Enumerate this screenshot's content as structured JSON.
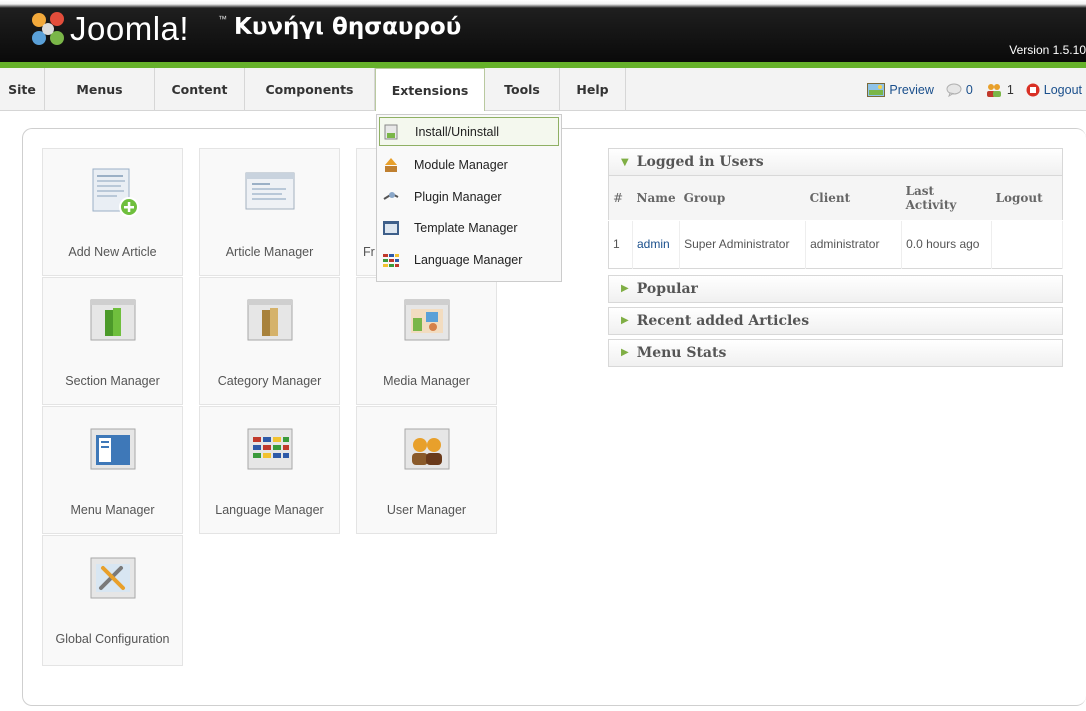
{
  "header": {
    "logo_text": "Joomla!",
    "logo_tm": "™",
    "site_title": "Κυνήγι θησαυρού",
    "version": "Version 1.5.10"
  },
  "menu": {
    "items": [
      {
        "label": "Site"
      },
      {
        "label": "Menus"
      },
      {
        "label": "Content"
      },
      {
        "label": "Components"
      },
      {
        "label": "Extensions",
        "active": true
      },
      {
        "label": "Tools"
      },
      {
        "label": "Help"
      }
    ]
  },
  "status": {
    "preview": "Preview",
    "messages": "0",
    "users_online": "1",
    "logout": "Logout"
  },
  "extensions_menu": {
    "items": [
      {
        "label": "Install/Uninstall",
        "icon": "install-icon"
      },
      {
        "label": "Module Manager",
        "icon": "module-icon"
      },
      {
        "label": "Plugin Manager",
        "icon": "plugin-icon"
      },
      {
        "label": "Template Manager",
        "icon": "template-icon"
      },
      {
        "label": "Language Manager",
        "icon": "language-icon"
      }
    ]
  },
  "quick_icons": {
    "add_article": "Add New Article",
    "article_manager": "Article Manager",
    "frontpage_manager_partial": "Fr",
    "section_manager": "Section Manager",
    "category_manager": "Category Manager",
    "media_manager": "Media Manager",
    "menu_manager": "Menu Manager",
    "language_manager": "Language Manager",
    "user_manager": "User Manager",
    "global_configuration": "Global Configuration"
  },
  "panels": {
    "logged_in": {
      "title": "Logged in Users",
      "columns": [
        "#",
        "Name",
        "Group",
        "Client",
        "Last Activity",
        "Logout"
      ],
      "rows": [
        {
          "num": "1",
          "name": "admin",
          "group": "Super Administrator",
          "client": "administrator",
          "last_activity": "0.0 hours ago",
          "logout": ""
        }
      ]
    },
    "popular": "Popular",
    "recent": "Recent added Articles",
    "menu_stats": "Menu Stats"
  },
  "colors": {
    "accent_green": "#66b12a",
    "link_blue": "#1a4f8c",
    "header_black": "#0a0a0a"
  }
}
